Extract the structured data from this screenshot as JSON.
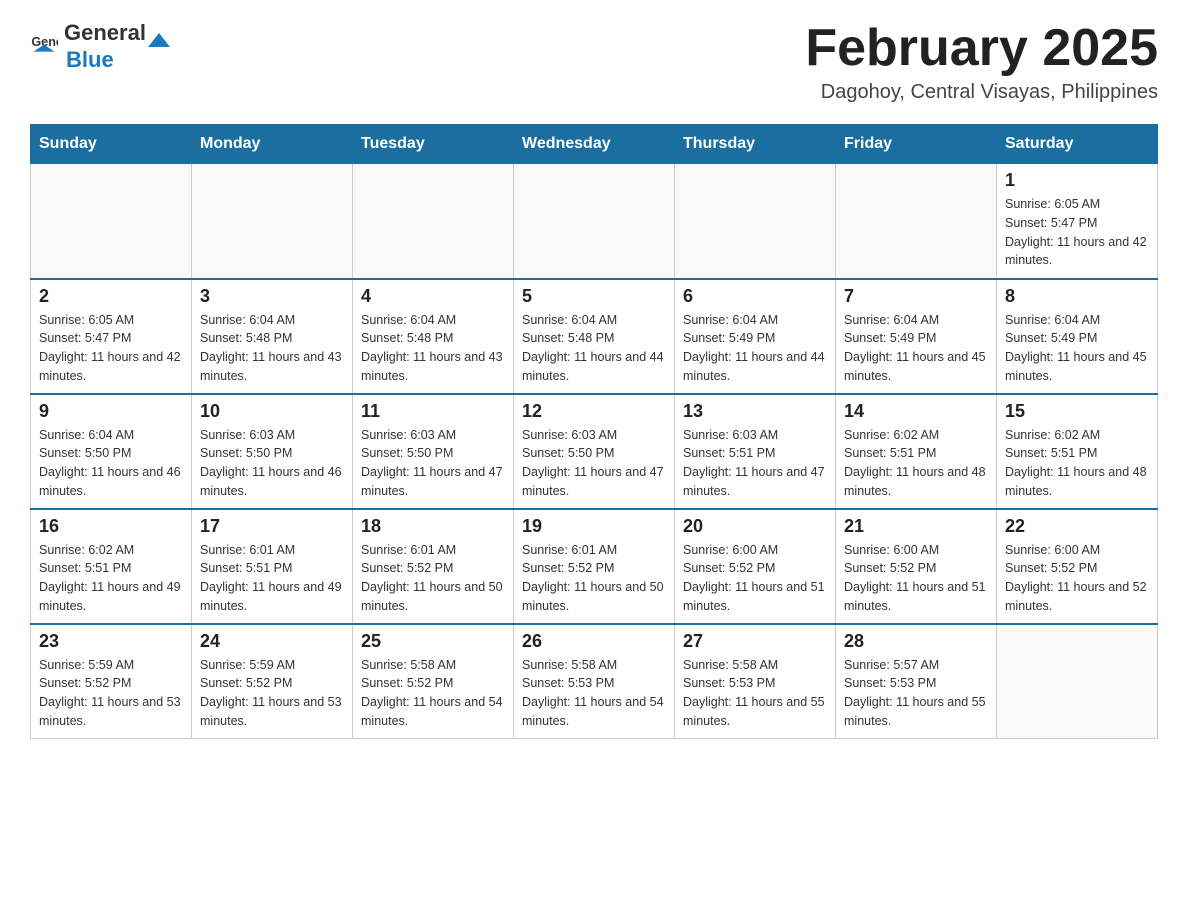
{
  "header": {
    "logo_general": "General",
    "logo_blue": "Blue",
    "title": "February 2025",
    "subtitle": "Dagohoy, Central Visayas, Philippines"
  },
  "days_of_week": [
    "Sunday",
    "Monday",
    "Tuesday",
    "Wednesday",
    "Thursday",
    "Friday",
    "Saturday"
  ],
  "weeks": [
    [
      {
        "day": "",
        "info": ""
      },
      {
        "day": "",
        "info": ""
      },
      {
        "day": "",
        "info": ""
      },
      {
        "day": "",
        "info": ""
      },
      {
        "day": "",
        "info": ""
      },
      {
        "day": "",
        "info": ""
      },
      {
        "day": "1",
        "info": "Sunrise: 6:05 AM\nSunset: 5:47 PM\nDaylight: 11 hours and 42 minutes."
      }
    ],
    [
      {
        "day": "2",
        "info": "Sunrise: 6:05 AM\nSunset: 5:47 PM\nDaylight: 11 hours and 42 minutes."
      },
      {
        "day": "3",
        "info": "Sunrise: 6:04 AM\nSunset: 5:48 PM\nDaylight: 11 hours and 43 minutes."
      },
      {
        "day": "4",
        "info": "Sunrise: 6:04 AM\nSunset: 5:48 PM\nDaylight: 11 hours and 43 minutes."
      },
      {
        "day": "5",
        "info": "Sunrise: 6:04 AM\nSunset: 5:48 PM\nDaylight: 11 hours and 44 minutes."
      },
      {
        "day": "6",
        "info": "Sunrise: 6:04 AM\nSunset: 5:49 PM\nDaylight: 11 hours and 44 minutes."
      },
      {
        "day": "7",
        "info": "Sunrise: 6:04 AM\nSunset: 5:49 PM\nDaylight: 11 hours and 45 minutes."
      },
      {
        "day": "8",
        "info": "Sunrise: 6:04 AM\nSunset: 5:49 PM\nDaylight: 11 hours and 45 minutes."
      }
    ],
    [
      {
        "day": "9",
        "info": "Sunrise: 6:04 AM\nSunset: 5:50 PM\nDaylight: 11 hours and 46 minutes."
      },
      {
        "day": "10",
        "info": "Sunrise: 6:03 AM\nSunset: 5:50 PM\nDaylight: 11 hours and 46 minutes."
      },
      {
        "day": "11",
        "info": "Sunrise: 6:03 AM\nSunset: 5:50 PM\nDaylight: 11 hours and 47 minutes."
      },
      {
        "day": "12",
        "info": "Sunrise: 6:03 AM\nSunset: 5:50 PM\nDaylight: 11 hours and 47 minutes."
      },
      {
        "day": "13",
        "info": "Sunrise: 6:03 AM\nSunset: 5:51 PM\nDaylight: 11 hours and 47 minutes."
      },
      {
        "day": "14",
        "info": "Sunrise: 6:02 AM\nSunset: 5:51 PM\nDaylight: 11 hours and 48 minutes."
      },
      {
        "day": "15",
        "info": "Sunrise: 6:02 AM\nSunset: 5:51 PM\nDaylight: 11 hours and 48 minutes."
      }
    ],
    [
      {
        "day": "16",
        "info": "Sunrise: 6:02 AM\nSunset: 5:51 PM\nDaylight: 11 hours and 49 minutes."
      },
      {
        "day": "17",
        "info": "Sunrise: 6:01 AM\nSunset: 5:51 PM\nDaylight: 11 hours and 49 minutes."
      },
      {
        "day": "18",
        "info": "Sunrise: 6:01 AM\nSunset: 5:52 PM\nDaylight: 11 hours and 50 minutes."
      },
      {
        "day": "19",
        "info": "Sunrise: 6:01 AM\nSunset: 5:52 PM\nDaylight: 11 hours and 50 minutes."
      },
      {
        "day": "20",
        "info": "Sunrise: 6:00 AM\nSunset: 5:52 PM\nDaylight: 11 hours and 51 minutes."
      },
      {
        "day": "21",
        "info": "Sunrise: 6:00 AM\nSunset: 5:52 PM\nDaylight: 11 hours and 51 minutes."
      },
      {
        "day": "22",
        "info": "Sunrise: 6:00 AM\nSunset: 5:52 PM\nDaylight: 11 hours and 52 minutes."
      }
    ],
    [
      {
        "day": "23",
        "info": "Sunrise: 5:59 AM\nSunset: 5:52 PM\nDaylight: 11 hours and 53 minutes."
      },
      {
        "day": "24",
        "info": "Sunrise: 5:59 AM\nSunset: 5:52 PM\nDaylight: 11 hours and 53 minutes."
      },
      {
        "day": "25",
        "info": "Sunrise: 5:58 AM\nSunset: 5:52 PM\nDaylight: 11 hours and 54 minutes."
      },
      {
        "day": "26",
        "info": "Sunrise: 5:58 AM\nSunset: 5:53 PM\nDaylight: 11 hours and 54 minutes."
      },
      {
        "day": "27",
        "info": "Sunrise: 5:58 AM\nSunset: 5:53 PM\nDaylight: 11 hours and 55 minutes."
      },
      {
        "day": "28",
        "info": "Sunrise: 5:57 AM\nSunset: 5:53 PM\nDaylight: 11 hours and 55 minutes."
      },
      {
        "day": "",
        "info": ""
      }
    ]
  ]
}
